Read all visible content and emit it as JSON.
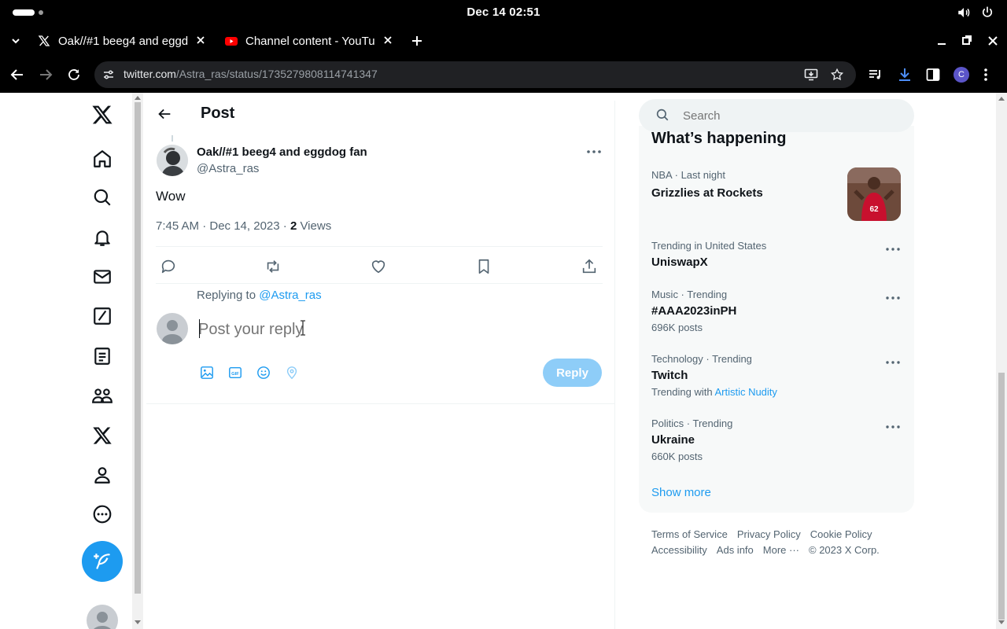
{
  "os": {
    "clock": "Dec 14  02:51"
  },
  "tabs": [
    {
      "title": "Oak//#1 beeg4 and eggdog fan",
      "favicon": "x-logo-icon"
    },
    {
      "title": "Channel content - YouTube",
      "favicon": "youtube-icon"
    }
  ],
  "toolbar": {
    "url_host": "twitter.com",
    "url_path": "/Astra_ras/status/1735279808114741347",
    "profile_initial": "C"
  },
  "header": {
    "title": "Post"
  },
  "post": {
    "author_name": "Oak//#1 beeg4 and eggdog fan",
    "author_handle": "@Astra_ras",
    "text": "Wow",
    "timestamp": "7:45 AM · Dec 14, 2023 · ",
    "views_count": "2",
    "views_label": " Views"
  },
  "reply": {
    "replying_to_label": "Replying to ",
    "replying_to_handle": "@Astra_ras",
    "placeholder": "Post your reply",
    "button": "Reply"
  },
  "search": {
    "placeholder": "Search"
  },
  "trends": {
    "title": "What’s happening",
    "items": [
      {
        "context": "NBA · Last night",
        "name": "Grizzlies at Rockets",
        "sub": ""
      },
      {
        "context": "Trending in United States",
        "name": "UniswapX",
        "sub": ""
      },
      {
        "context": "Music · Trending",
        "name": "#AAA2023inPH",
        "sub": "696K posts"
      },
      {
        "context": "Technology · Trending",
        "name": "Twitch",
        "sub_prefix": "Trending with ",
        "sub_link": "Artistic Nudity"
      },
      {
        "context": "Politics · Trending",
        "name": "Ukraine",
        "sub": "660K posts"
      }
    ],
    "show_more": "Show more"
  },
  "footer": {
    "row1": [
      "Terms of Service",
      "Privacy Policy",
      "Cookie Policy"
    ],
    "row2": [
      "Accessibility",
      "Ads info",
      "More ···",
      "© 2023 X Corp."
    ]
  },
  "colors": {
    "accent": "#1d9bf0",
    "reply_disabled": "#8ecdf8",
    "text": "#0f1419",
    "muted": "#536471"
  }
}
